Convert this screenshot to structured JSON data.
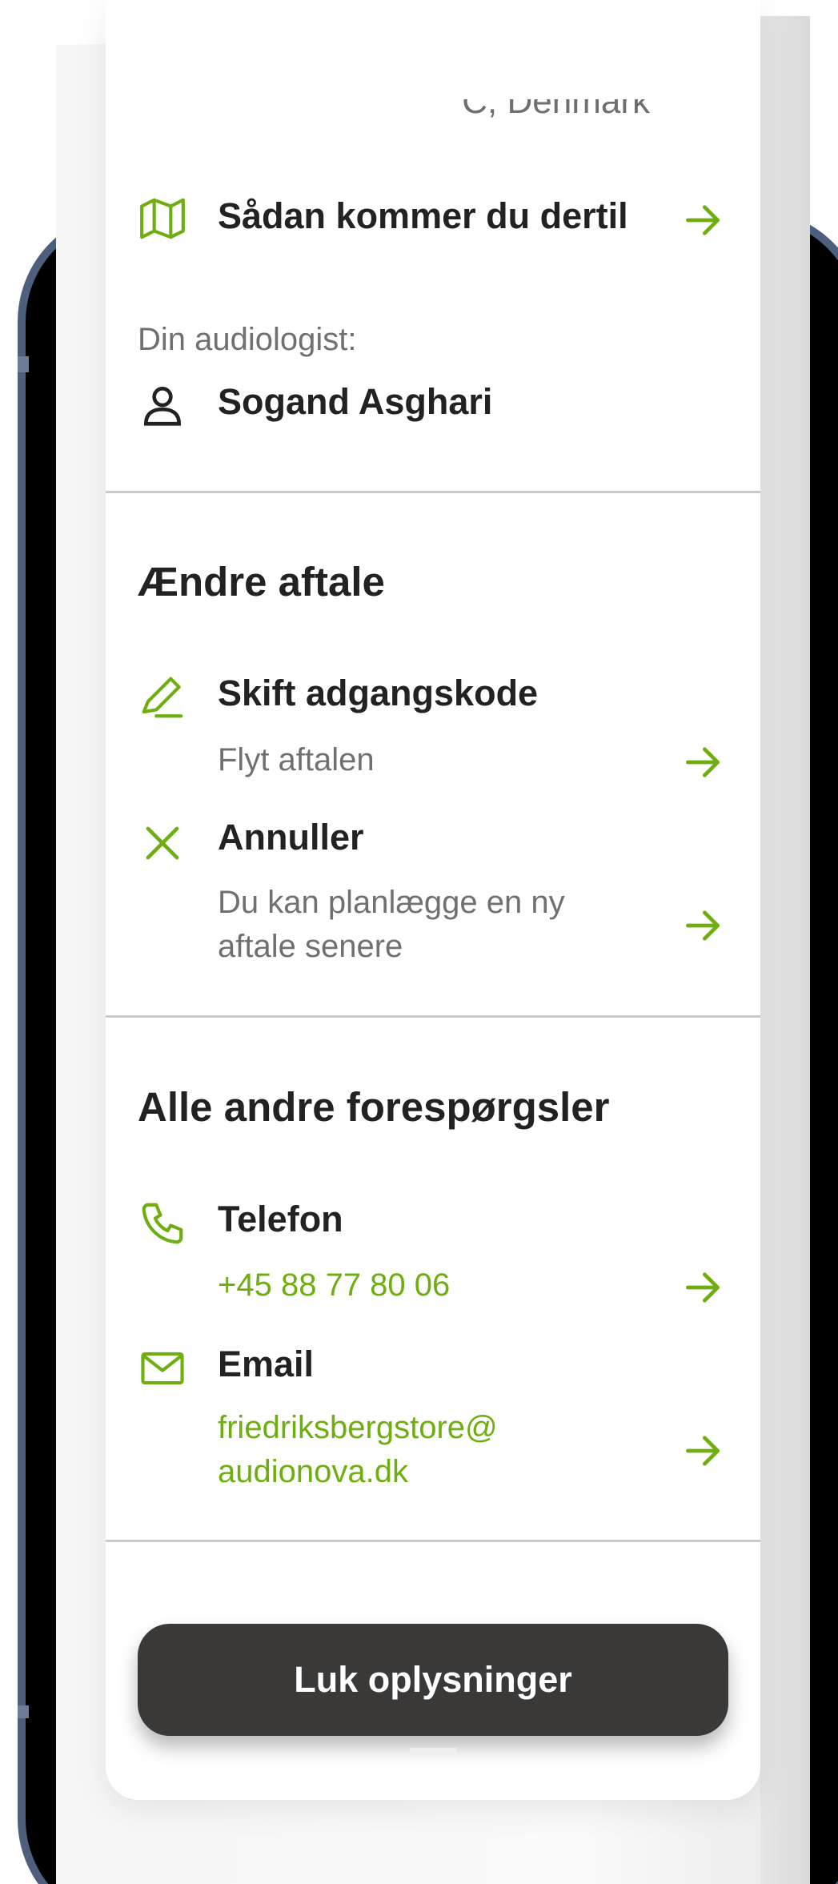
{
  "location": {
    "address_tail": "Frederiksberg C, Denmark",
    "directions_label": "Sådan kommer du dertil",
    "audiologist_label": "Din audiologist:",
    "audiologist_name": "Sogand Asghari"
  },
  "change_section": {
    "title": "Ændre aftale",
    "items": [
      {
        "title": "Skift adgangskode",
        "subtitle": "Flyt aftalen",
        "icon": "pencil-icon"
      },
      {
        "title": "Annuller",
        "subtitle_line1": "Du kan planlægge en ny",
        "subtitle_line2": "aftale senere",
        "icon": "close-x-icon"
      }
    ]
  },
  "contact_section": {
    "title": "Alle andre forespørgsler",
    "phone_label": "Telefon",
    "phone_number": "+45 88 77 80 06",
    "email_label": "Email",
    "email_line1": "friedriksbergstore@",
    "email_line2": "audionova.dk"
  },
  "close_button_label": "Luk oplysninger",
  "colors": {
    "accent": "#6fae10",
    "button_bg": "#3b3838",
    "text_primary": "#222222",
    "text_secondary": "#707070",
    "phone_frame": "#4d5f7d"
  }
}
